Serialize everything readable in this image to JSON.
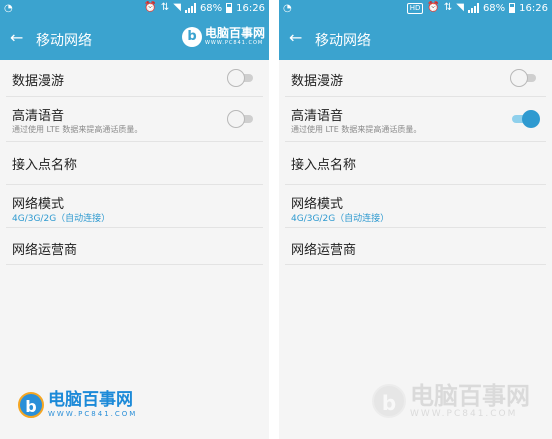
{
  "statusbar": {
    "left_icon": "carrier-icon",
    "battery_text": "68%",
    "time": "16:26",
    "hd_label": "HD"
  },
  "appbar": {
    "title": "移动网络"
  },
  "settings": {
    "data_roaming": "数据漫游",
    "volte_title": "高清语音",
    "volte_desc": "通过使用 LTE 数据来提高通话质量。",
    "apn": "接入点名称",
    "network_mode": "网络模式",
    "network_mode_value": "4G/3G/2G（自动连接）",
    "operators": "网络运营商"
  },
  "screens": [
    {
      "volte_on": false,
      "data_roaming_on": false
    },
    {
      "volte_on": true,
      "data_roaming_on": false
    }
  ],
  "watermark": {
    "name": "电脑百事网",
    "url": "WWW.PC841.COM",
    "mark": "b"
  },
  "colors": {
    "accent": "#3ba3cf",
    "switch_on": "#2f9ad0"
  }
}
